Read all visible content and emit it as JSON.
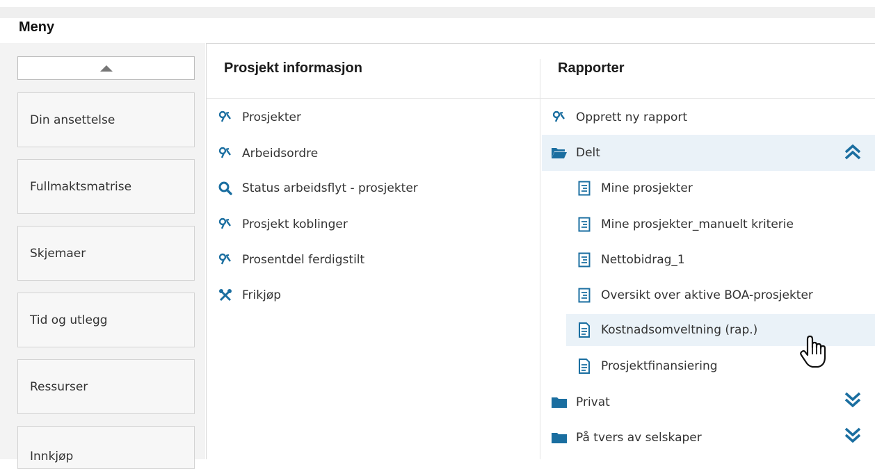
{
  "menu": {
    "title": "Meny"
  },
  "sidebar": {
    "items": [
      {
        "label": "Din ansettelse"
      },
      {
        "label": "Fullmaktsmatrise"
      },
      {
        "label": "Skjemaer"
      },
      {
        "label": "Tid og utlegg"
      },
      {
        "label": "Ressurser"
      },
      {
        "label": "Innkjøp"
      }
    ]
  },
  "project_info": {
    "heading": "Prosjekt informasjon",
    "items": [
      {
        "label": "Prosjekter",
        "icon": "tools-icon"
      },
      {
        "label": "Arbeidsordre",
        "icon": "tools-icon"
      },
      {
        "label": "Status arbeidsflyt - prosjekter",
        "icon": "search-icon"
      },
      {
        "label": "Prosjekt koblinger",
        "icon": "tools-icon"
      },
      {
        "label": "Prosentdel ferdigstilt",
        "icon": "tools-icon"
      },
      {
        "label": "Frikjøp",
        "icon": "wrench-cross-icon"
      }
    ]
  },
  "reports": {
    "heading": "Rapporter",
    "create": {
      "label": "Opprett ny rapport",
      "icon": "tools-icon"
    },
    "shared_folder": {
      "label": "Delt",
      "expanded": true,
      "items": [
        {
          "label": "Mine prosjekter",
          "icon": "report-icon"
        },
        {
          "label": "Mine prosjekter_manuelt kriterie",
          "icon": "report-icon"
        },
        {
          "label": "Nettobidrag_1",
          "icon": "report-icon"
        },
        {
          "label": "Oversikt over aktive BOA-prosjekter",
          "icon": "report-icon"
        },
        {
          "label": "Kostnadsomveltning (rap.)",
          "icon": "document-icon",
          "hovered": true
        },
        {
          "label": "Prosjektfinansiering",
          "icon": "document-icon"
        }
      ]
    },
    "private_folder": {
      "label": "Privat",
      "expanded": false
    },
    "cross_company_folder": {
      "label": "På tvers av selskaper",
      "expanded": false
    }
  },
  "colors": {
    "accent": "#1a6ea0",
    "hover": "#eaf2f8"
  }
}
